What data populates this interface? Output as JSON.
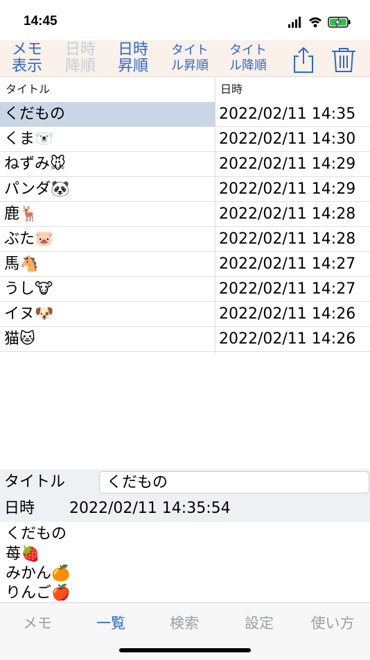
{
  "status_bar": {
    "time": "14:45"
  },
  "toolbar": {
    "memo_display": "メモ\n表示",
    "date_desc": "日時\n降順",
    "date_asc": "日時\n昇順",
    "title_asc": "タイト\nル昇順",
    "title_desc": "タイト\nル降順",
    "share_icon": "share-icon",
    "trash_icon": "trash-icon"
  },
  "list": {
    "header": {
      "title": "タイトル",
      "date": "日時"
    },
    "rows": [
      {
        "title": "くだもの",
        "date": "2022/02/11 14:35",
        "selected": true
      },
      {
        "title": "くま🐻‍❄️",
        "date": "2022/02/11 14:30"
      },
      {
        "title": "ねずみ🐭",
        "date": "2022/02/11 14:29"
      },
      {
        "title": "パンダ🐼",
        "date": "2022/02/11 14:29"
      },
      {
        "title": "鹿🦌",
        "date": "2022/02/11 14:28"
      },
      {
        "title": "ぶた🐷",
        "date": "2022/02/11 14:28"
      },
      {
        "title": "馬🐴",
        "date": "2022/02/11 14:27"
      },
      {
        "title": "うし🐮",
        "date": "2022/02/11 14:27"
      },
      {
        "title": "イヌ🐶",
        "date": "2022/02/11 14:26"
      },
      {
        "title": "猫🐱",
        "date": "2022/02/11 14:26"
      }
    ]
  },
  "detail": {
    "title_label": "タイトル",
    "title_value": "くだもの",
    "date_label": "日時",
    "date_value": "2022/02/11 14:35:54",
    "memo_lines": [
      "くだもの",
      "苺🍓",
      "みかん🍊",
      "りんご🍎"
    ]
  },
  "tabbar": {
    "tabs": [
      "メモ",
      "一覧",
      "検索",
      "設定",
      "使い方"
    ],
    "active": "一覧"
  },
  "colors": {
    "accent": "#2b67d6",
    "selected_row": "#c9d6e6",
    "toolbar_bg": "#f9f1ea"
  }
}
